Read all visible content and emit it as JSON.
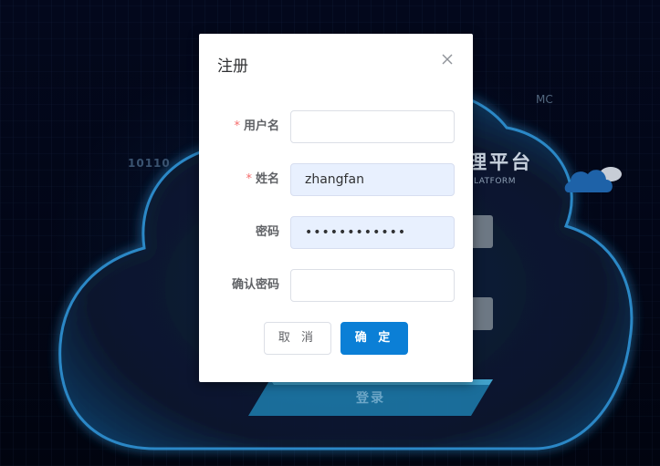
{
  "background": {
    "platform_title": "理平台",
    "platform_subtitle": "LATFORM",
    "digits": "10110",
    "corner_text": "MC",
    "login_button": "登录"
  },
  "dialog": {
    "title": "注册",
    "close_icon": "close-icon",
    "fields": [
      {
        "label": "用户名",
        "required_mark": "*",
        "value": "",
        "placeholder": ""
      },
      {
        "label": "姓名",
        "required_mark": "*",
        "value": "zhangfan",
        "placeholder": ""
      },
      {
        "label": "密码",
        "required_mark": "",
        "value": "••••••••••••",
        "placeholder": ""
      },
      {
        "label": "确认密码",
        "required_mark": "",
        "value": "",
        "placeholder": ""
      }
    ],
    "cancel_label": "取 消",
    "confirm_label": "确 定"
  },
  "colors": {
    "primary": "#0b7fd6",
    "required": "#f56c6c",
    "autofill": "#e8f0fe",
    "backdrop": "#02071a"
  }
}
